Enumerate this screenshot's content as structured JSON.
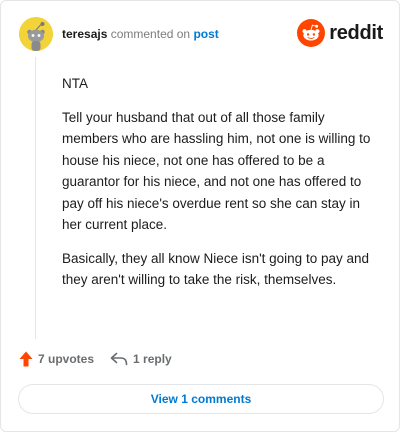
{
  "comment": {
    "username": "teresajs",
    "action_text": "commented on",
    "post_link": "post",
    "paragraphs": [
      "NTA",
      "Tell your husband that out of all those family members who are hassling him, not one is willing to house his niece, not one has offered to be a guarantor for his niece, and not one has offered to pay off his niece's overdue rent so she can stay in her current place.",
      "Basically, they all know Niece isn't going to pay and they aren't willing to take the risk, themselves."
    ]
  },
  "brand": {
    "wordmark": "reddit",
    "color": "#ff4500"
  },
  "actions": {
    "upvotes_label": "7 upvotes",
    "reply_label": "1 reply"
  },
  "footer": {
    "view_comments_label": "View 1 comments"
  },
  "icons": {
    "avatar": "snoo-avatar-icon",
    "logo": "reddit-logo-icon",
    "upvote": "upvote-arrow-icon",
    "reply": "reply-arrow-icon"
  },
  "colors": {
    "avatar_bg": "#f2d33a",
    "upvote": "#ff4500",
    "link": "#0079d3"
  }
}
